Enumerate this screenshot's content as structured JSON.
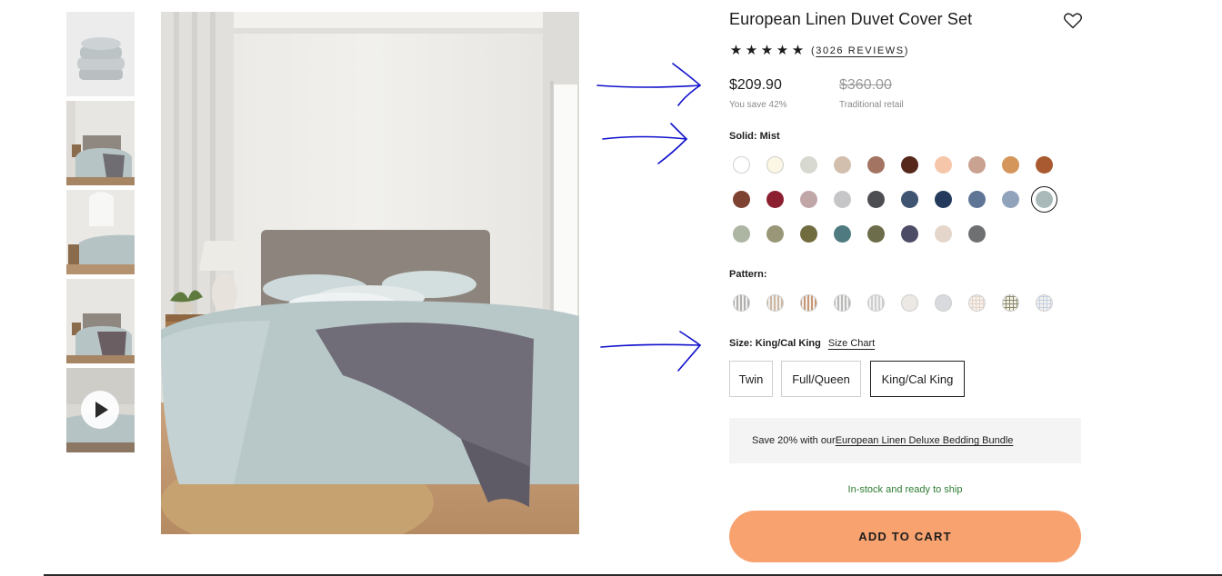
{
  "product": {
    "title": "European Linen Duvet Cover Set",
    "rating_stars": 5,
    "reviews_prefix": "(",
    "reviews_text": "3026 REVIEWS",
    "reviews_suffix": ")",
    "price_now": "$209.90",
    "you_save": "You save 42%",
    "price_was": "$360.00",
    "retail_label": "Traditional retail"
  },
  "solid": {
    "label": "Solid:",
    "selected": "Mist",
    "swatches": [
      {
        "name": "white",
        "color": "#ffffff"
      },
      {
        "name": "cream",
        "color": "#fbf7e4"
      },
      {
        "name": "fog",
        "color": "#d7d8d0"
      },
      {
        "name": "sand",
        "color": "#d3bfae"
      },
      {
        "name": "clay",
        "color": "#a47463"
      },
      {
        "name": "espresso",
        "color": "#56281b"
      },
      {
        "name": "peach",
        "color": "#f6c6ab"
      },
      {
        "name": "blush",
        "color": "#caa291"
      },
      {
        "name": "amber",
        "color": "#d5965b"
      },
      {
        "name": "rust",
        "color": "#a95a30"
      },
      {
        "name": "brick",
        "color": "#7e4232"
      },
      {
        "name": "crimson",
        "color": "#8b1f30"
      },
      {
        "name": "mauve",
        "color": "#c1a6a8"
      },
      {
        "name": "pebble",
        "color": "#c6c6c8"
      },
      {
        "name": "charcoal",
        "color": "#4d4e52"
      },
      {
        "name": "denim",
        "color": "#3e5470"
      },
      {
        "name": "navy",
        "color": "#233a5c"
      },
      {
        "name": "slate-blue",
        "color": "#5e7595"
      },
      {
        "name": "dusk-blue",
        "color": "#91a2bb"
      },
      {
        "name": "mist",
        "color": "#a9b9b9"
      },
      {
        "name": "sage",
        "color": "#adb5a3"
      },
      {
        "name": "olive-grey",
        "color": "#999778"
      },
      {
        "name": "olive",
        "color": "#716b40"
      },
      {
        "name": "teal",
        "color": "#4f7b80"
      },
      {
        "name": "moss",
        "color": "#6d6d4b"
      },
      {
        "name": "eclipse",
        "color": "#4d4c66"
      },
      {
        "name": "oat",
        "color": "#e4d6cb"
      },
      {
        "name": "pinstripe-grey",
        "color": "#6f7072"
      }
    ]
  },
  "pattern": {
    "label": "Pattern:",
    "swatches": [
      {
        "name": "stripe-charcoal",
        "color": "#b0aeb0"
      },
      {
        "name": "stripe-sand",
        "color": "#cbb7a2"
      },
      {
        "name": "stripe-rust",
        "color": "#c99676"
      },
      {
        "name": "stripe-grey",
        "color": "#b8b9bb"
      },
      {
        "name": "stripe-light-grey",
        "color": "#cdcecf"
      },
      {
        "name": "solid-ivory",
        "color": "#ece8e3"
      },
      {
        "name": "solid-silver",
        "color": "#d9dade"
      },
      {
        "name": "grid-blush",
        "color": "#e4d3c8"
      },
      {
        "name": "grid-olive",
        "color": "#8a8a6a"
      },
      {
        "name": "grid-blue",
        "color": "#c4d0e4"
      }
    ]
  },
  "size": {
    "label": "Size:",
    "selected": "King/Cal King",
    "chart_link": "Size Chart",
    "options": [
      "Twin",
      "Full/Queen",
      "King/Cal King"
    ]
  },
  "bundle": {
    "text": "Save 20% with our",
    "link": " European Linen Deluxe Bedding Bundle"
  },
  "stock_text": "In-stock and ready to ship",
  "cart_label": "ADD TO CART",
  "colors": {
    "accent": "#f7a26f",
    "in_stock": "#2e7d32",
    "annotation": "#1010cc"
  },
  "icons": {
    "wishlist": "heart-icon",
    "rating": "star-icon",
    "video": "play-icon"
  }
}
